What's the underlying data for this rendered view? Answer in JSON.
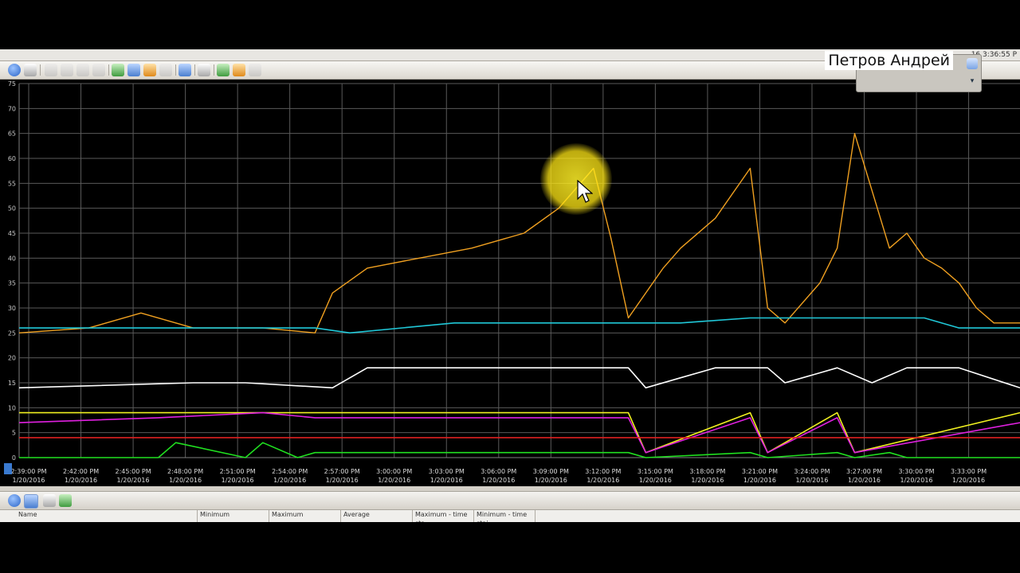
{
  "window": {
    "title_time": "16 3:36:55 P"
  },
  "watermark": "Петров Андрей",
  "toolbar": {
    "icons": [
      "help-icon",
      "view-icon",
      "first-icon",
      "previous-icon",
      "next-icon",
      "last-icon",
      "zoom-icon",
      "pan-icon",
      "highlight-icon",
      "properties-icon",
      "freeze-icon",
      "print-icon",
      "add-counter-icon",
      "delete-counter-icon",
      "more-icon"
    ]
  },
  "bottom_toolbar": {
    "icons": [
      "help-icon",
      "fit-icon",
      "print-icon",
      "export-icon"
    ]
  },
  "table": {
    "columns": [
      "Name",
      "Minimum",
      "Maximum",
      "Average",
      "Maximum - time sta",
      "Minimum - time stai"
    ]
  },
  "chart_data": {
    "type": "line",
    "ylim": [
      0,
      75
    ],
    "yticks": [
      "0",
      "5",
      "10",
      "15",
      "20",
      "25",
      "30",
      "35",
      "40",
      "45",
      "50",
      "55",
      "60",
      "65",
      "70",
      "75"
    ],
    "grid": true,
    "xlim_minutes": [
      0,
      57.5
    ],
    "xticks": [
      {
        "time": "2:39:00 PM",
        "date": "1/20/2016"
      },
      {
        "time": "2:42:00 PM",
        "date": "1/20/2016"
      },
      {
        "time": "2:45:00 PM",
        "date": "1/20/2016"
      },
      {
        "time": "2:48:00 PM",
        "date": "1/20/2016"
      },
      {
        "time": "2:51:00 PM",
        "date": "1/20/2016"
      },
      {
        "time": "2:54:00 PM",
        "date": "1/20/2016"
      },
      {
        "time": "2:57:00 PM",
        "date": "1/20/2016"
      },
      {
        "time": "3:00:00 PM",
        "date": "1/20/2016"
      },
      {
        "time": "3:03:00 PM",
        "date": "1/20/2016"
      },
      {
        "time": "3:06:00 PM",
        "date": "1/20/2016"
      },
      {
        "time": "3:09:00 PM",
        "date": "1/20/2016"
      },
      {
        "time": "3:12:00 PM",
        "date": "1/20/2016"
      },
      {
        "time": "3:15:00 PM",
        "date": "1/20/2016"
      },
      {
        "time": "3:18:00 PM",
        "date": "1/20/2016"
      },
      {
        "time": "3:21:00 PM",
        "date": "1/20/2016"
      },
      {
        "time": "3:24:00 PM",
        "date": "1/20/2016"
      },
      {
        "time": "3:27:00 PM",
        "date": "1/20/2016"
      },
      {
        "time": "3:30:00 PM",
        "date": "1/20/2016"
      },
      {
        "time": "3:33:00 PM",
        "date": "1/20/2016"
      }
    ],
    "series": [
      {
        "color": "#f0a020",
        "x": [
          0,
          4,
          7,
          10,
          14,
          17,
          18,
          20,
          23,
          26,
          29,
          31,
          33,
          34,
          35,
          37,
          38,
          40,
          42,
          43,
          44,
          46,
          47,
          48,
          50,
          51,
          52,
          53,
          54,
          55,
          56,
          57.5
        ],
        "y": [
          25,
          26,
          29,
          26,
          26,
          25,
          33,
          38,
          40,
          42,
          45,
          50,
          58,
          44,
          28,
          38,
          42,
          48,
          58,
          30,
          27,
          35,
          42,
          65,
          42,
          45,
          40,
          38,
          35,
          30,
          27,
          27
        ]
      },
      {
        "color": "#20c8d8",
        "x": [
          0,
          17,
          19,
          25,
          35,
          38,
          42,
          47,
          52,
          54,
          57.5
        ],
        "y": [
          26,
          26,
          25,
          27,
          27,
          27,
          28,
          28,
          28,
          26,
          26
        ]
      },
      {
        "color": "#ffffff",
        "x": [
          0,
          10,
          13,
          18,
          20,
          35,
          36,
          38,
          40,
          43,
          44,
          46,
          47,
          49,
          51,
          54,
          57.5
        ],
        "y": [
          14,
          15,
          15,
          14,
          18,
          18,
          14,
          16,
          18,
          18,
          15,
          17,
          18,
          15,
          18,
          18,
          14
        ]
      },
      {
        "color": "#f0f020",
        "x": [
          0,
          35,
          36,
          42,
          43,
          47,
          48,
          57.5
        ],
        "y": [
          9,
          9,
          1,
          9,
          1,
          9,
          1,
          9
        ]
      },
      {
        "color": "#e020e0",
        "x": [
          0,
          8,
          14,
          17,
          35,
          36,
          42,
          43,
          47,
          48,
          57.5
        ],
        "y": [
          7,
          8,
          9,
          8,
          8,
          1,
          8,
          1,
          8,
          1,
          7
        ]
      },
      {
        "color": "#e02020",
        "x": [
          0,
          57.5
        ],
        "y": [
          4,
          4
        ]
      },
      {
        "color": "#20e020",
        "x": [
          0,
          8,
          9,
          13,
          14,
          16,
          17,
          35,
          36,
          42,
          43,
          47,
          48,
          50,
          51,
          57.5
        ],
        "y": [
          0,
          0,
          3,
          0,
          3,
          0,
          1,
          1,
          0,
          1,
          0,
          1,
          0,
          1,
          0,
          0
        ]
      }
    ]
  }
}
